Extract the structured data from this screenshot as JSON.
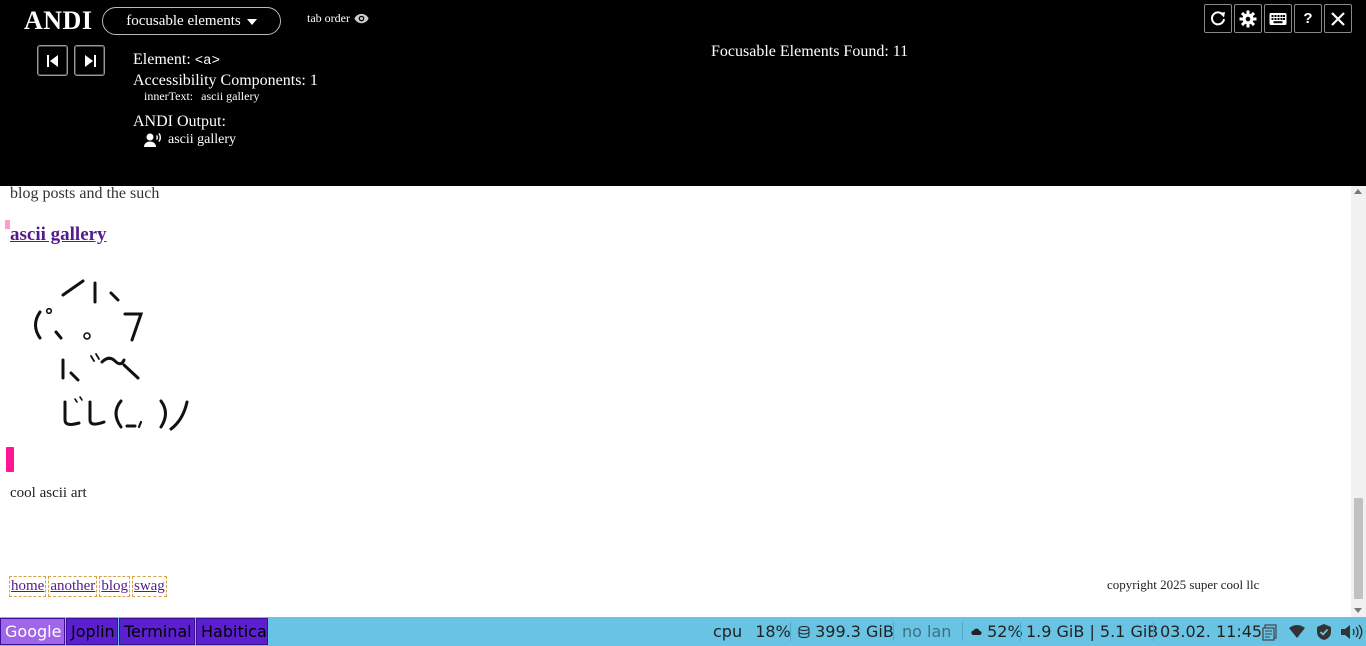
{
  "andi": {
    "logo": "ANDI",
    "module": "focusable elements",
    "tab_order": "tab order",
    "element_label": "Element:",
    "element_value": "<a>",
    "components_label": "Accessibility Components:",
    "components_count": "1",
    "inner_text_label": "innerText:",
    "inner_text_value": "ascii gallery",
    "output_label": "ANDI Output:",
    "output_value": "ascii gallery",
    "found_text": "Focusable Elements Found: 11",
    "help_label": "?",
    "icons": {
      "prev": "previous-element-icon",
      "next": "next-element-icon",
      "refresh": "refresh-icon",
      "settings": "gear-icon",
      "keyboard": "keyboard-icon",
      "close": "close-icon",
      "eye": "eye-icon",
      "speaker": "speaking-person-icon"
    }
  },
  "page": {
    "intro": "blog posts and the such",
    "gallery_link": "ascii gallery",
    "ascii_art": [
      "／l、",
      "（ﾟ､ ｡ ７",
      "l、 ~ヽ",
      "じしf_, )ノ"
    ],
    "caption": "cool ascii art",
    "footer_links": [
      "home",
      "another",
      "blog",
      "swag"
    ],
    "copyright": "copyright 2025 super cool llc",
    "link_color": "#551a8b",
    "focus_marker_color": "#ff1493"
  },
  "taskbar": {
    "tasks": [
      {
        "label": "Google",
        "active": true
      },
      {
        "label": "Joplin",
        "active": false
      },
      {
        "label": "Terminal",
        "active": false
      },
      {
        "label": "Habitica",
        "active": false
      }
    ],
    "cpu_label": "cpu",
    "cpu_value": "18%",
    "disk": "399.3 GiB",
    "lan": "no lan",
    "weather": "52%",
    "memory": "1.9 GiB | 5.1 GiB",
    "datetime": "03.02. 11:45",
    "background_color": "#69c4e4",
    "task_color": "#5b1fcf",
    "active_task_color": "#a066e8"
  }
}
